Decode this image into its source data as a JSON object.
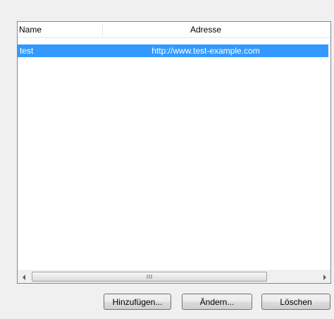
{
  "list": {
    "columns": {
      "name": "Name",
      "address": "Adresse"
    },
    "rows": [
      {
        "name": "test",
        "address": "http://www.test-example.com",
        "selected": true
      }
    ],
    "selection_color": "#3399ff"
  },
  "buttons": {
    "add_label": "Hinzufügen...",
    "edit_label": "Ändern...",
    "delete_label": "Löschen"
  }
}
